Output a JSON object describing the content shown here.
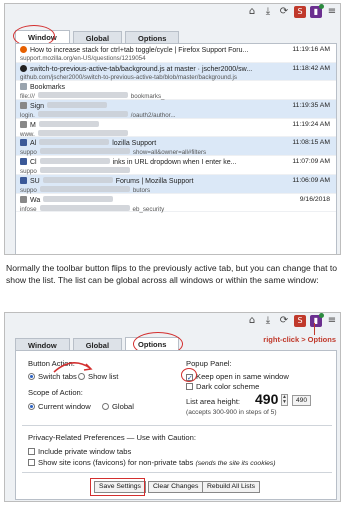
{
  "top_window": {
    "tabs": [
      "Window",
      "Global",
      "Options"
    ],
    "rows": [
      {
        "title": "How to increase stack for ctrl+tab toggle/cycle | Firefox Support Foru...",
        "url": "support.mozilla.org/en-US/questions/1219054",
        "time": "11:19:16 AM",
        "icon": "firefox-icon",
        "hl": false
      },
      {
        "title": "switch-to-previous-active-tab/background.js at master · jscher2000/sw...",
        "url": "github.com/jscher2000/switch-to-previous-active-tab/blob/master/background.js",
        "time": "11:18:42 AM",
        "icon": "github-icon",
        "hl": true
      },
      {
        "title": "Bookmarks",
        "url": "file:///",
        "url_tail": "bookmarks_",
        "time": "",
        "icon": "bookmark-icon",
        "hl": false
      },
      {
        "title": "Sign",
        "url": "login.",
        "url_tail": "/oauth2/author...",
        "time": "11:19:35 AM",
        "icon": "page-icon",
        "hl": true
      },
      {
        "title": "M",
        "url": "www.",
        "url_tail": "",
        "time": "11:19:24 AM",
        "icon": "page-icon",
        "hl": false
      },
      {
        "title": "Al",
        "title_tail": "lozilla Support",
        "url": "suppo",
        "url_tail": "show=all&owner=all#filters",
        "time": "11:08:15 AM",
        "icon": "mozilla-icon",
        "hl": true
      },
      {
        "title": "Cl",
        "title_tail": "inks in URL dropdown when I enter ke...",
        "url": "suppo",
        "url_tail": "",
        "time": "11:07:09 AM",
        "icon": "mozilla-icon",
        "hl": false
      },
      {
        "title": "SU",
        "title_tail": "Forums | Mozilla Support",
        "url": "suppo",
        "url_tail": "butors",
        "time": "11:06:09 AM",
        "icon": "mozilla-icon",
        "hl": true
      },
      {
        "title": "Wa",
        "title_tail": "",
        "url": "infose",
        "url_tail": "eb_security",
        "time": "9/16/2018",
        "icon": "page-icon",
        "hl": false
      }
    ]
  },
  "paragraph": "Normally the toolbar button flips to the previously active tab, but you can change that to show the list. The list can be global across all windows or within the same window:",
  "options_window": {
    "tabs": [
      "Window",
      "Global",
      "Options"
    ],
    "annotation": "right-click > Options",
    "button_action_heading": "Button Action:",
    "switch_tabs_label": "Switch tabs",
    "show_list_label": "Show list",
    "scope_heading": "Scope of Action:",
    "current_window_label": "Current window",
    "global_label": "Global",
    "popup_heading": "Popup Panel:",
    "keep_open_label": "Keep open in same window",
    "dark_scheme_label": "Dark color scheme",
    "list_height_label": "List area height:",
    "list_height_value": "490",
    "list_height_button": "490",
    "list_height_hint": "(accepts 300-900 in steps of 5)",
    "privacy_heading": "Privacy-Related Preferences — Use with Caution:",
    "include_private_label": "Include private window tabs",
    "show_icons_label": "Show site icons (favicons) for non-private tabs",
    "show_icons_note": "(sends the site its cookies)",
    "save_button": "Save Settings",
    "clear_button": "Clear Changes",
    "rebuild_button": "Rebuild All Lists"
  },
  "toolbar_icons": [
    "home-icon",
    "download-icon",
    "sync-icon",
    "extension-red-icon",
    "extension-purple-icon",
    "menu-icon"
  ]
}
